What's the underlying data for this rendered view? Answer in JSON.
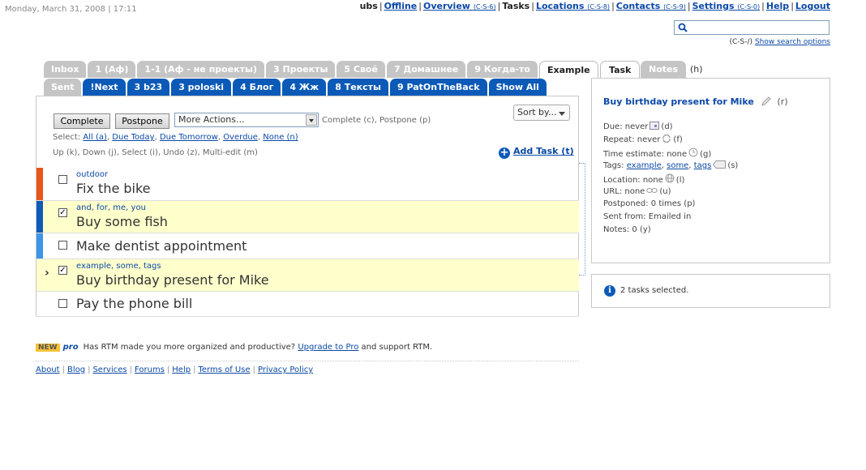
{
  "datetime": "Monday, March 31, 2008 | 17:11",
  "topnav": {
    "user": "ubs",
    "offline": "Offline",
    "overview": "Overview",
    "overview_sc": "(C-S-6)",
    "tasks": "Tasks",
    "locations": "Locations",
    "locations_sc": "(C-S-8)",
    "contacts": "Contacts",
    "contacts_sc": "(C-S-9)",
    "settings": "Settings",
    "settings_sc": "(C-S-0)",
    "help": "Help",
    "logout": "Logout"
  },
  "search": {
    "value": "",
    "shortcut": "(C-S-/)",
    "options_label": "Show search options"
  },
  "list_tabs_row1": [
    {
      "label": "Inbox",
      "style": "grey"
    },
    {
      "label": "1 (Аф)",
      "style": "grey"
    },
    {
      "label": "1-1 (Аф - не проекты)",
      "style": "grey"
    },
    {
      "label": "3 Проекты",
      "style": "grey"
    },
    {
      "label": "5 Своё",
      "style": "grey"
    },
    {
      "label": "7 Домашнее",
      "style": "grey"
    },
    {
      "label": "9 Когда-то",
      "style": "grey"
    },
    {
      "label": "Example",
      "style": "active"
    }
  ],
  "list_tabs_row2": [
    {
      "label": "Sent",
      "style": "grey"
    },
    {
      "label": "!Next",
      "style": "blue"
    },
    {
      "label": "3 b23",
      "style": "blue"
    },
    {
      "label": "3 poloski",
      "style": "blue"
    },
    {
      "label": "4 Блог",
      "style": "blue"
    },
    {
      "label": "4 Жж",
      "style": "blue"
    },
    {
      "label": "8 Тексты",
      "style": "blue"
    },
    {
      "label": "9 PatOnTheBack",
      "style": "blue"
    },
    {
      "label": "Show All",
      "style": "blue"
    }
  ],
  "toolbar": {
    "complete": "Complete",
    "postpone": "Postpone",
    "more_actions": "More Actions...",
    "shortcuts_hint": "Complete (c), Postpone (p)",
    "sort_by": "Sort by...",
    "select_label": "Select:",
    "select_all": "All (a)",
    "select_today": "Due Today",
    "select_tomorrow": "Due Tomorrow",
    "select_overdue": "Overdue",
    "select_none": "None (n)",
    "nav_hint": "Up (k), Down (j), Select (i), Undo (z), Multi-edit (m)",
    "add_task": "Add Task (t)"
  },
  "tasks": [
    {
      "tags": "outdoor",
      "name": "Fix the bike",
      "checked": false,
      "selected": false,
      "priority_color": "#e8561a"
    },
    {
      "tags": "and, for, me, you",
      "name": "Buy some fish",
      "checked": true,
      "selected": true,
      "priority_color": "#0c5bb8"
    },
    {
      "tags": "",
      "name": "Make dentist appointment",
      "checked": false,
      "selected": false,
      "priority_color": "#3d95e8"
    },
    {
      "tags": "example, some, tags",
      "name": "Buy birthday present for Mike",
      "checked": true,
      "selected": true,
      "priority_color": ""
    },
    {
      "tags": "",
      "name": "Pay the phone bill",
      "checked": false,
      "selected": false,
      "priority_color": ""
    }
  ],
  "promo": {
    "new_badge": "NEW",
    "pro": "pro",
    "text_before": "Has RTM made you more organized and productive?",
    "link": "Upgrade to Pro",
    "text_after": "and support RTM."
  },
  "footer": [
    "About",
    "Blog",
    "Services",
    "Forums",
    "Help",
    "Terms of Use",
    "Privacy Policy"
  ],
  "right_tabs": {
    "task": "Task",
    "notes": "Notes",
    "help_key": "(h)"
  },
  "details": {
    "title": "Buy birthday present for Mike",
    "title_key": "(r)",
    "due": "Due: never",
    "due_key": "(d)",
    "repeat": "Repeat: never",
    "repeat_key": "(f)",
    "estimate": "Time estimate: none",
    "estimate_key": "(g)",
    "tags_label": "Tags:",
    "tag1": "example",
    "tag2": "some",
    "tag3": "tags",
    "tags_key": "(s)",
    "location": "Location: none",
    "location_key": "(l)",
    "url": "URL: none",
    "url_key": "(u)",
    "postponed": "Postponed: 0 times (p)",
    "sent_from": "Sent from: Emailed in",
    "notes": "Notes: 0 (y)"
  },
  "status": {
    "text": "2 tasks selected."
  },
  "colors": {
    "link": "#0b49a7",
    "tab_blue": "#0b5ab8",
    "tab_grey": "#c5c5c5",
    "selected_row": "#ffffcc"
  }
}
